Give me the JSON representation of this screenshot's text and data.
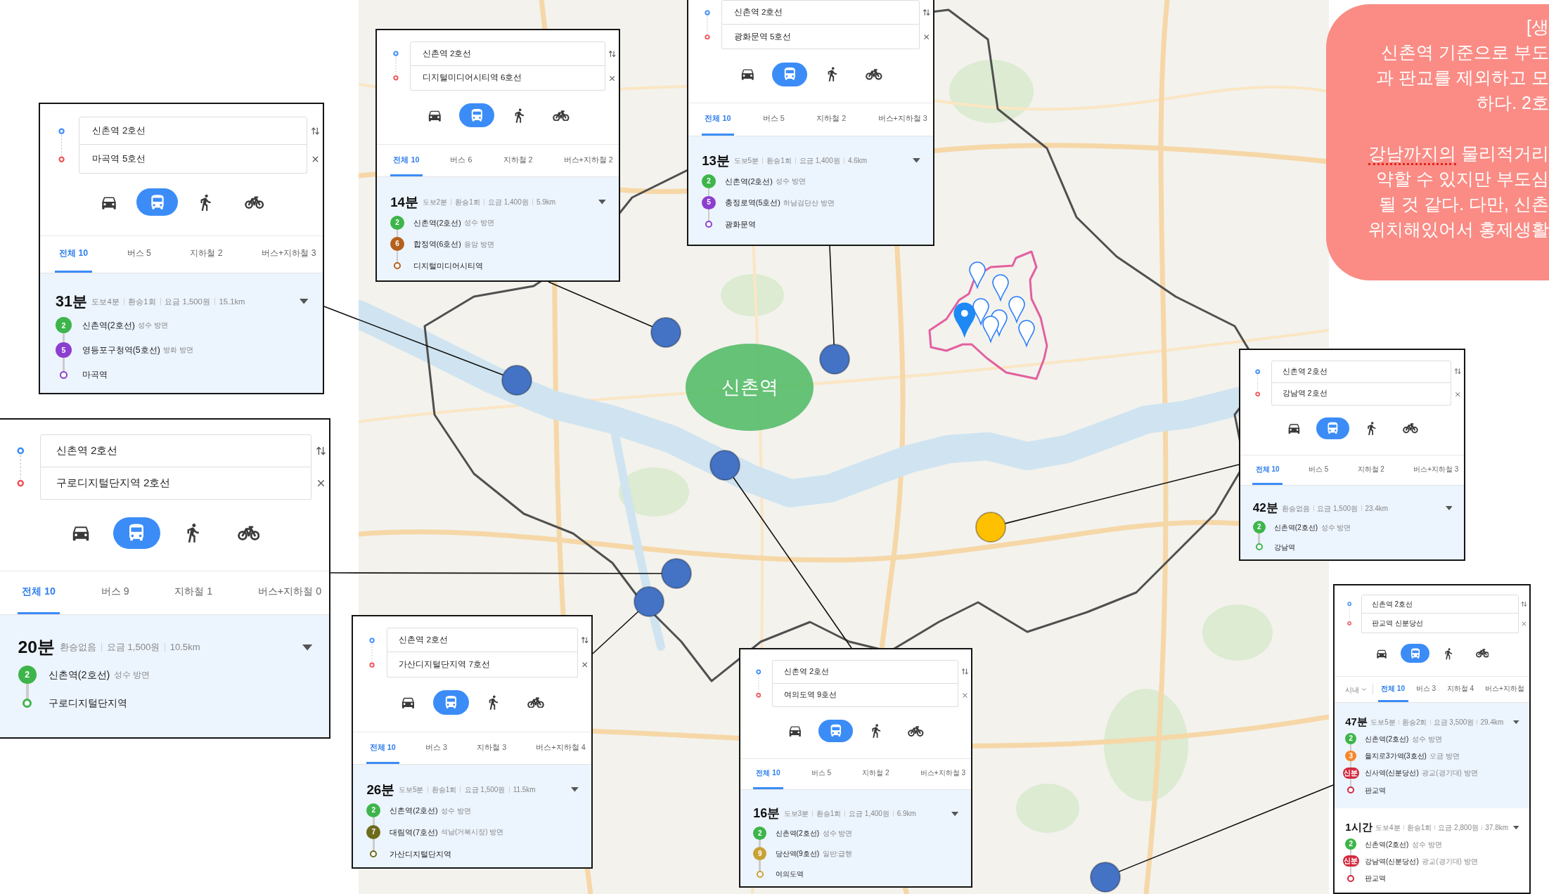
{
  "map": {
    "area_label": "신촌역"
  },
  "route_cards": [
    {
      "origin": "신촌역 2호선",
      "destination": "마곡역 5호선",
      "modes": [
        {
          "kind": "car",
          "selected": false
        },
        {
          "kind": "bus",
          "selected": true
        },
        {
          "kind": "walk",
          "selected": false
        },
        {
          "kind": "bike",
          "selected": false
        }
      ],
      "tabs": [
        {
          "label": "전체 10",
          "selected": true
        },
        {
          "label": "버스 5",
          "selected": false
        },
        {
          "label": "지하철 2",
          "selected": false
        },
        {
          "label": "버스+지하철 3",
          "selected": false
        }
      ],
      "routes": [
        {
          "selected": true,
          "duration": "31분",
          "details": [
            "도보4분",
            "환승1회",
            "요금 1,500원",
            "15.1km"
          ],
          "steps": [
            {
              "line": "2",
              "color": "#3db54a",
              "station": "신촌역(2호선)",
              "direction": "성수 방면"
            },
            {
              "line": "5",
              "color": "#8c3fcf",
              "station": "영등포구청역(5호선)",
              "direction": "방화 방면"
            }
          ],
          "arrival": {
            "station": "마곡역",
            "color": "#8c3fcf"
          }
        }
      ],
      "marker": {
        "color": "#4472c4"
      }
    },
    {
      "origin": "신촌역 2호선",
      "destination": "디지털미디어시티역 6호선",
      "modes": [
        {
          "kind": "car",
          "selected": false
        },
        {
          "kind": "bus",
          "selected": true
        },
        {
          "kind": "walk",
          "selected": false
        },
        {
          "kind": "bike",
          "selected": false
        }
      ],
      "tabs": [
        {
          "label": "전체 10",
          "selected": true
        },
        {
          "label": "버스 6",
          "selected": false
        },
        {
          "label": "지하철 2",
          "selected": false
        },
        {
          "label": "버스+지하철 2",
          "selected": false
        }
      ],
      "routes": [
        {
          "selected": true,
          "duration": "14분",
          "details": [
            "도보2분",
            "환승1회",
            "요금 1,400원",
            "5.9km"
          ],
          "steps": [
            {
              "line": "2",
              "color": "#3db54a",
              "station": "신촌역(2호선)",
              "direction": "성수 방면"
            },
            {
              "line": "6",
              "color": "#b3601c",
              "station": "합정역(6호선)",
              "direction": "응암 방면"
            }
          ],
          "arrival": {
            "station": "디지털미디어시티역",
            "color": "#b3601c"
          }
        }
      ],
      "marker": {
        "color": "#4472c4"
      }
    },
    {
      "origin": "신촌역 2호선",
      "destination": "광화문역 5호선",
      "modes": [
        {
          "kind": "car",
          "selected": false
        },
        {
          "kind": "bus",
          "selected": true
        },
        {
          "kind": "walk",
          "selected": false
        },
        {
          "kind": "bike",
          "selected": false
        }
      ],
      "tabs": [
        {
          "label": "전체 10",
          "selected": true
        },
        {
          "label": "버스 5",
          "selected": false
        },
        {
          "label": "지하철 2",
          "selected": false
        },
        {
          "label": "버스+지하철 3",
          "selected": false
        }
      ],
      "routes": [
        {
          "selected": true,
          "duration": "13분",
          "details": [
            "도보5분",
            "환승1회",
            "요금 1,400원",
            "4.6km"
          ],
          "steps": [
            {
              "line": "2",
              "color": "#3db54a",
              "station": "신촌역(2호선)",
              "direction": "성수 방면"
            },
            {
              "line": "5",
              "color": "#8c3fcf",
              "station": "충정로역(5호선)",
              "direction": "하남검단산 방면"
            }
          ],
          "arrival": {
            "station": "광화문역",
            "color": "#8c3fcf"
          }
        }
      ],
      "marker": {
        "color": "#4472c4"
      }
    },
    {
      "origin": "신촌역 2호선",
      "destination": "구로디지털단지역 2호선",
      "modes": [
        {
          "kind": "car",
          "selected": false
        },
        {
          "kind": "bus",
          "selected": true
        },
        {
          "kind": "walk",
          "selected": false
        },
        {
          "kind": "bike",
          "selected": false
        }
      ],
      "tabs": [
        {
          "label": "전체 10",
          "selected": true
        },
        {
          "label": "버스 9",
          "selected": false
        },
        {
          "label": "지하철 1",
          "selected": false
        },
        {
          "label": "버스+지하철 0",
          "selected": false
        }
      ],
      "routes": [
        {
          "selected": true,
          "duration": "20분",
          "details": [
            "환승없음",
            "요금 1,500원",
            "10.5km"
          ],
          "steps": [
            {
              "line": "2",
              "color": "#3db54a",
              "station": "신촌역(2호선)",
              "direction": "성수 방면"
            }
          ],
          "arrival": {
            "station": "구로디지털단지역",
            "color": "#3db54a"
          }
        }
      ],
      "marker": {
        "color": "#4472c4"
      }
    },
    {
      "origin": "신촌역 2호선",
      "destination": "강남역 2호선",
      "modes": [
        {
          "kind": "car",
          "selected": false
        },
        {
          "kind": "bus",
          "selected": true
        },
        {
          "kind": "walk",
          "selected": false
        },
        {
          "kind": "bike",
          "selected": false
        }
      ],
      "tabs": [
        {
          "label": "전체 10",
          "selected": true
        },
        {
          "label": "버스 5",
          "selected": false
        },
        {
          "label": "지하철 2",
          "selected": false
        },
        {
          "label": "버스+지하철 3",
          "selected": false
        }
      ],
      "routes": [
        {
          "selected": true,
          "duration": "42분",
          "details": [
            "환승없음",
            "요금 1,500원",
            "23.4km"
          ],
          "steps": [
            {
              "line": "2",
              "color": "#3db54a",
              "station": "신촌역(2호선)",
              "direction": "성수 방면"
            }
          ],
          "arrival": {
            "station": "강남역",
            "color": "#3db54a"
          }
        }
      ],
      "marker": {
        "color": "#ffc000"
      }
    },
    {
      "origin": "신촌역 2호선",
      "destination": "가산디지털단지역 7호선",
      "modes": [
        {
          "kind": "car",
          "selected": false
        },
        {
          "kind": "bus",
          "selected": true
        },
        {
          "kind": "walk",
          "selected": false
        },
        {
          "kind": "bike",
          "selected": false
        }
      ],
      "tabs": [
        {
          "label": "전체 10",
          "selected": true
        },
        {
          "label": "버스 3",
          "selected": false
        },
        {
          "label": "지하철 3",
          "selected": false
        },
        {
          "label": "버스+지하철 4",
          "selected": false
        }
      ],
      "routes": [
        {
          "selected": true,
          "duration": "26분",
          "details": [
            "도보5분",
            "환승1회",
            "요금 1,500원",
            "11.5km"
          ],
          "steps": [
            {
              "line": "2",
              "color": "#3db54a",
              "station": "신촌역(2호선)",
              "direction": "성수 방면"
            },
            {
              "line": "7",
              "color": "#6e6b1c",
              "station": "대림역(7호선)",
              "direction": "석남(거북시장) 방면"
            }
          ],
          "arrival": {
            "station": "가산디지털단지역",
            "color": "#6e6b1c"
          }
        }
      ],
      "marker": {
        "color": "#4472c4"
      }
    },
    {
      "origin": "신촌역 2호선",
      "destination": "여의도역 9호선",
      "modes": [
        {
          "kind": "car",
          "selected": false
        },
        {
          "kind": "bus",
          "selected": true
        },
        {
          "kind": "walk",
          "selected": false
        },
        {
          "kind": "bike",
          "selected": false
        }
      ],
      "tabs": [
        {
          "label": "전체 10",
          "selected": true
        },
        {
          "label": "버스 5",
          "selected": false
        },
        {
          "label": "지하철 2",
          "selected": false
        },
        {
          "label": "버스+지하철 3",
          "selected": false
        }
      ],
      "routes": [
        {
          "selected": true,
          "duration": "16분",
          "details": [
            "도보3분",
            "환승1회",
            "요금 1,400원",
            "6.9km"
          ],
          "steps": [
            {
              "line": "2",
              "color": "#3db54a",
              "station": "신촌역(2호선)",
              "direction": "성수 방면"
            },
            {
              "line": "9",
              "color": "#c9a236",
              "station": "당산역(9호선)",
              "direction": "일반:급행"
            }
          ],
          "arrival": {
            "station": "여의도역",
            "color": "#c9a236"
          }
        }
      ],
      "marker": {
        "color": "#4472c4"
      }
    },
    {
      "origin": "신촌역 2호선",
      "destination": "판교역 신분당선",
      "modes": [
        {
          "kind": "car",
          "selected": false
        },
        {
          "kind": "bus",
          "selected": true
        },
        {
          "kind": "walk",
          "selected": false
        },
        {
          "kind": "bike",
          "selected": false
        }
      ],
      "filter": "시내",
      "tabs": [
        {
          "label": "전체 10",
          "selected": true
        },
        {
          "label": "버스 3",
          "selected": false
        },
        {
          "label": "지하철 4",
          "selected": false
        },
        {
          "label": "버스+지하철",
          "selected": false
        }
      ],
      "routes": [
        {
          "selected": true,
          "duration": "47분",
          "details": [
            "도보5분",
            "환승2회",
            "요금 3,500원",
            "29.4km"
          ],
          "steps": [
            {
              "line": "2",
              "color": "#3db54a",
              "station": "신촌역(2호선)",
              "direction": "성수 방면"
            },
            {
              "line": "3",
              "color": "#f7862a",
              "station": "을지로3가역(3호선)",
              "direction": "오금 방면"
            },
            {
              "line": "신분",
              "color": "#d3283d",
              "station": "신사역(신분당선)",
              "direction": "광교(경기대) 방면"
            }
          ],
          "arrival": {
            "station": "판교역",
            "color": "#d3283d"
          }
        },
        {
          "selected": false,
          "duration": "1시간",
          "details": [
            "도보4분",
            "환승1회",
            "요금 2,800원",
            "37.8km"
          ],
          "steps": [
            {
              "line": "2",
              "color": "#3db54a",
              "station": "신촌역(2호선)",
              "direction": "성수 방면"
            },
            {
              "line": "신분",
              "color": "#d3283d",
              "station": "강남역(신분당선)",
              "direction": "광교(경기대) 방면"
            }
          ],
          "arrival": {
            "station": "판교역",
            "color": "#d3283d"
          }
        }
      ],
      "marker": {
        "color": "#4472c4"
      }
    }
  ],
  "note": {
    "paragraphs": [
      [
        [
          {
            "text": "[생",
            "misspelled": false
          }
        ],
        [
          {
            "text": "신촌역 기준으로 부도",
            "misspelled": false
          }
        ],
        [
          {
            "text": "과 판교를 제외하고 모",
            "misspelled": false
          }
        ],
        [
          {
            "text": "하다. 2호",
            "misspelled": false
          }
        ]
      ],
      [
        [
          {
            "text": "강남까지의",
            "misspelled": true
          },
          {
            "text": " 물리적거리",
            "misspelled": false
          }
        ],
        [
          {
            "text": "약할 수 있지만 부도심",
            "misspelled": false
          }
        ],
        [
          {
            "text": "될 것 같다. 다만, 신촌",
            "misspelled": false
          }
        ],
        [
          {
            "text": "위치해있어서 홍제생활",
            "misspelled": false
          }
        ]
      ]
    ]
  }
}
